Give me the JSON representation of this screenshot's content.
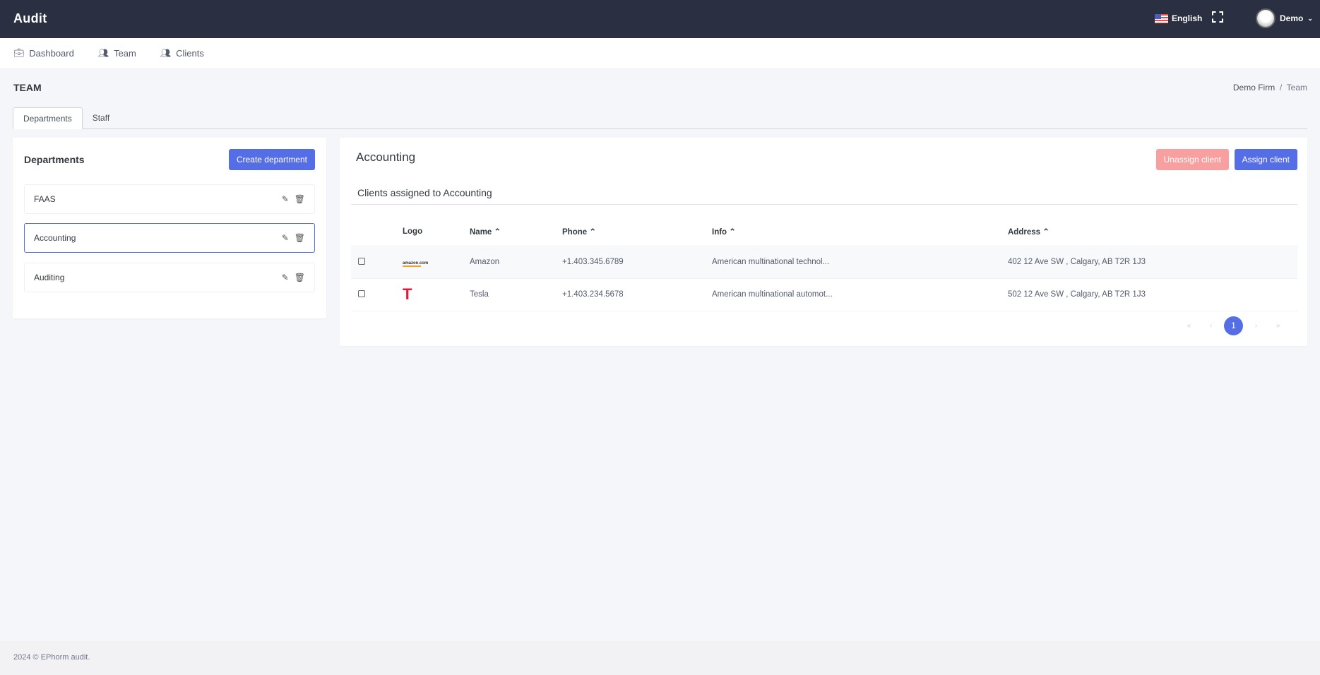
{
  "header": {
    "brand": "Audit",
    "language": "English",
    "user": "Demo"
  },
  "nav": [
    {
      "label": "Dashboard",
      "icon": "briefcase-icon"
    },
    {
      "label": "Team",
      "icon": "users-icon"
    },
    {
      "label": "Clients",
      "icon": "user-friends-icon"
    }
  ],
  "page": {
    "title": "TEAM",
    "breadcrumb": [
      "Demo Firm",
      "Team"
    ]
  },
  "tabs": [
    "Departments",
    "Staff"
  ],
  "departments": {
    "title": "Departments",
    "create_label": "Create department",
    "items": [
      "FAAS",
      "Accounting",
      "Auditing"
    ],
    "selected": "Accounting"
  },
  "detail": {
    "title": "Accounting",
    "unassign_label": "Unassign client",
    "assign_label": "Assign client",
    "subtitle": "Clients assigned to Accounting",
    "columns": [
      "Logo",
      "Name ⌃",
      "Phone ⌃",
      "Info ⌃",
      "Address ⌃"
    ],
    "rows": [
      {
        "logo": "amazon.com",
        "name": "Amazon",
        "phone": "+1.403.345.6789",
        "info": "American multinational technol...",
        "address": "402 12 Ave SW , Calgary, AB T2R 1J3"
      },
      {
        "logo": "T",
        "name": "Tesla",
        "phone": "+1.403.234.5678",
        "info": "American multinational automot...",
        "address": "502 12 Ave SW , Calgary, AB T2R 1J3"
      }
    ],
    "pagination": {
      "first": "«",
      "prev": "‹",
      "current": "1",
      "next": "›",
      "last": "»"
    }
  },
  "footer": "2024 © EPhorm audit.",
  "colors": {
    "topbar": "#2a3042",
    "primary": "#556ee6",
    "danger_light": "#f8a0a0"
  }
}
